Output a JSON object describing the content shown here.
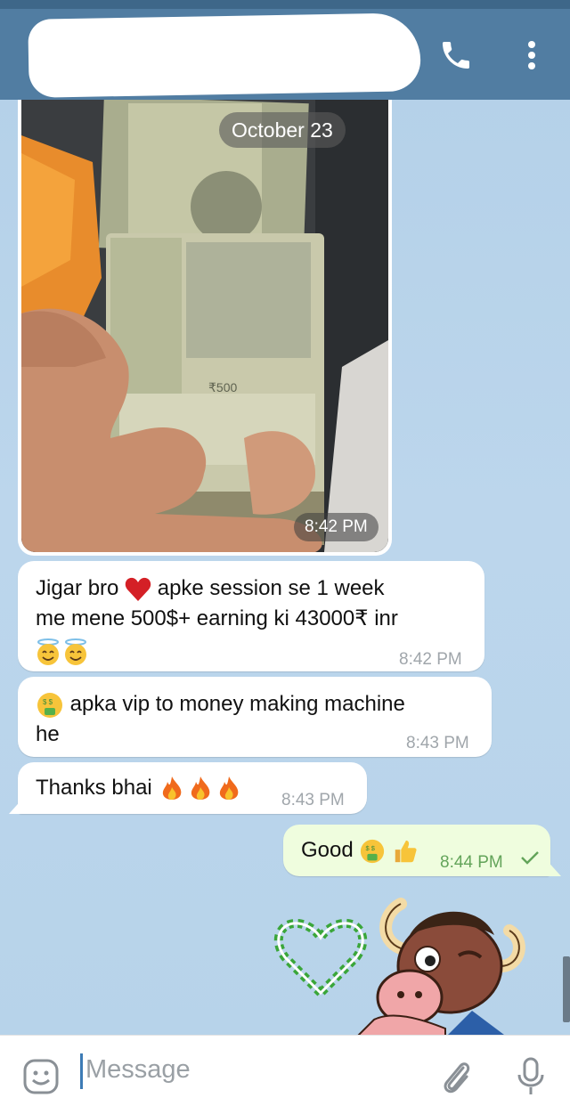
{
  "header": {
    "call_icon": "phone-icon",
    "menu_icon": "more-vertical-icon",
    "brand_color": "#517da2"
  },
  "chat": {
    "date_label": "October 23",
    "photo_message": {
      "time": "8:42 PM"
    },
    "messages": [
      {
        "direction": "in",
        "text_line1": "Jigar bro",
        "text_line1b": "apke session se 1 week",
        "text_line2": "me mene 500$+ earning ki 43000₹ inr",
        "time": "8:42 PM"
      },
      {
        "direction": "in",
        "text_line1": "apka vip to money making machine",
        "text_line2": "he",
        "time": "8:43 PM"
      },
      {
        "direction": "in",
        "text": "Thanks bhai",
        "time": "8:43 PM"
      },
      {
        "direction": "out",
        "text": "Good",
        "time": "8:44 PM",
        "status": "sent-check"
      }
    ]
  },
  "input": {
    "placeholder": "Message",
    "emoji_icon": "emoji-icon",
    "attach_icon": "paperclip-icon",
    "mic_icon": "microphone-icon"
  }
}
